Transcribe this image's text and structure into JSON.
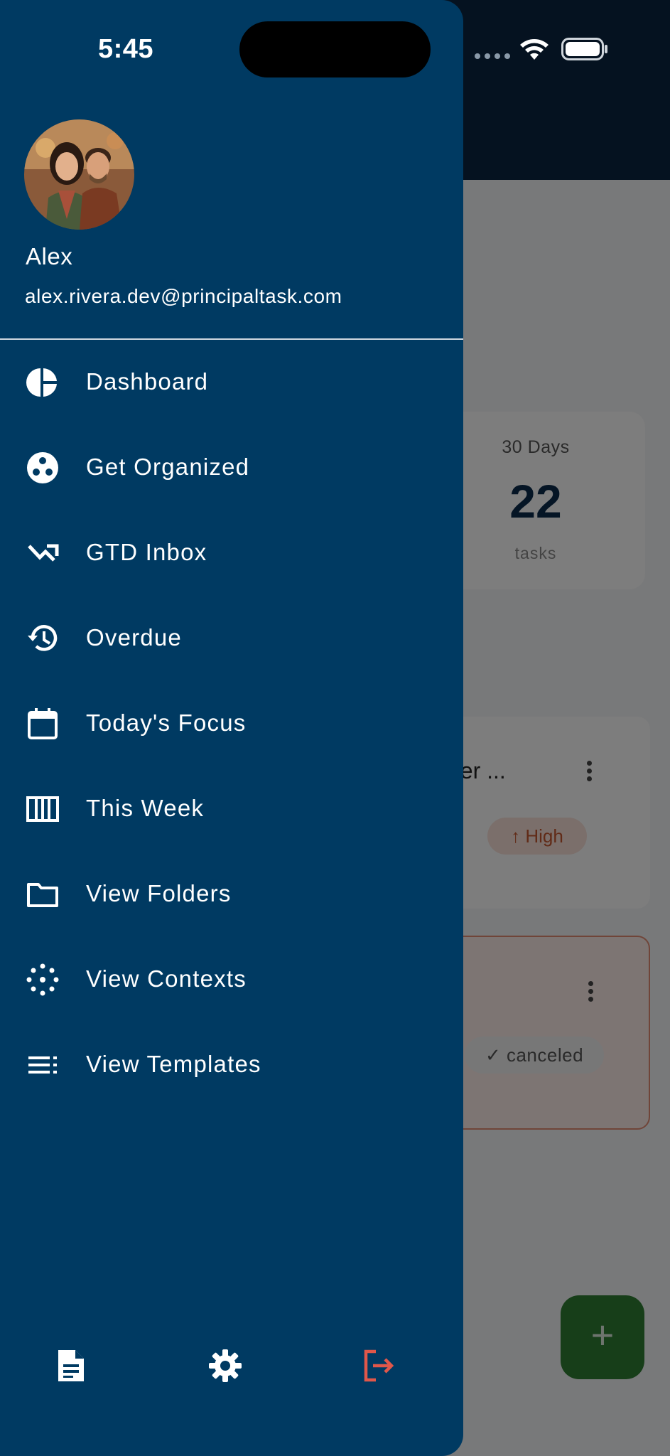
{
  "status_bar": {
    "time": "5:45"
  },
  "drawer": {
    "user": {
      "name": "Alex",
      "email": "alex.rivera.dev@principaltask.com"
    },
    "menu": [
      {
        "label": "Dashboard",
        "icon": "pie-chart-icon"
      },
      {
        "label": "Get Organized",
        "icon": "organize-icon"
      },
      {
        "label": "GTD Inbox",
        "icon": "inbox-arrow-icon"
      },
      {
        "label": "Overdue",
        "icon": "history-icon"
      },
      {
        "label": "Today's Focus",
        "icon": "calendar-icon"
      },
      {
        "label": "This Week",
        "icon": "week-columns-icon"
      },
      {
        "label": "View Folders",
        "icon": "folder-icon"
      },
      {
        "label": "View Contexts",
        "icon": "contexts-icon"
      },
      {
        "label": "View Templates",
        "icon": "templates-icon"
      }
    ],
    "bottom_actions": [
      "document-icon",
      "gear-icon",
      "logout-icon"
    ]
  },
  "background": {
    "stat_card": {
      "label": "30 Days",
      "value": "22",
      "unit": "tasks"
    },
    "tasks": [
      {
        "title_visible": "water ...",
        "priority": "High"
      },
      {
        "status": "canceled"
      }
    ],
    "fab_label": "+"
  },
  "colors": {
    "drawer_bg": "#003a62",
    "accent_logout": "#e0574a",
    "fab": "#2e7d32",
    "high_priority": "#c3562f"
  }
}
